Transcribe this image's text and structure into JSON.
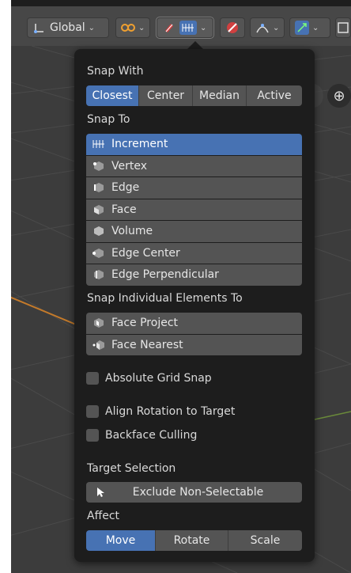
{
  "header": {
    "transform_orientation": "Global",
    "colors": {
      "accent": "#4772b3",
      "panel": "#1d1d1d",
      "button": "#545454"
    }
  },
  "popover": {
    "snap_with_label": "Snap With",
    "snap_with_options": [
      "Closest",
      "Center",
      "Median",
      "Active"
    ],
    "snap_with_selected": "Closest",
    "snap_to_label": "Snap To",
    "snap_to_items": [
      {
        "label": "Increment",
        "icon": "increment-icon",
        "selected": true
      },
      {
        "label": "Vertex",
        "icon": "vertex-icon",
        "selected": false
      },
      {
        "label": "Edge",
        "icon": "edge-icon",
        "selected": false
      },
      {
        "label": "Face",
        "icon": "face-icon",
        "selected": false
      },
      {
        "label": "Volume",
        "icon": "volume-icon",
        "selected": false
      },
      {
        "label": "Edge Center",
        "icon": "edge-center-icon",
        "selected": false
      },
      {
        "label": "Edge Perpendicular",
        "icon": "edge-perpendicular-icon",
        "selected": false
      }
    ],
    "individual_label": "Snap Individual Elements To",
    "individual_items": [
      {
        "label": "Face Project",
        "icon": "face-project-icon"
      },
      {
        "label": "Face Nearest",
        "icon": "face-nearest-icon"
      }
    ],
    "absolute_grid_snap": "Absolute Grid Snap",
    "align_rotation": "Align Rotation to Target",
    "backface_culling": "Backface Culling",
    "target_selection_label": "Target Selection",
    "target_selection_value": "Exclude Non-Selectable",
    "affect_label": "Affect",
    "affect_options": [
      "Move",
      "Rotate",
      "Scale"
    ],
    "affect_selected": "Move"
  }
}
